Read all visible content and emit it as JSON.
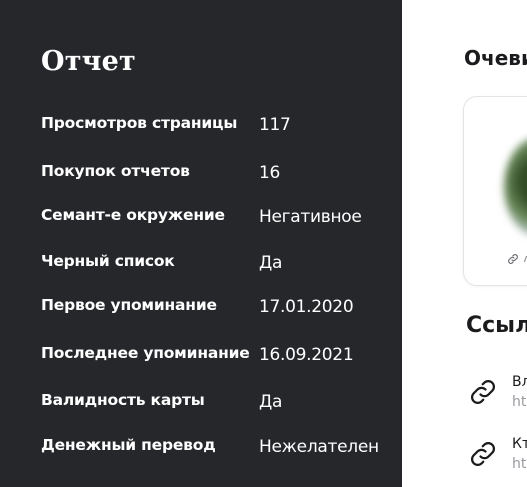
{
  "report": {
    "title": "Отчет",
    "rows": [
      {
        "label": "Просмотров страницы",
        "value": "117"
      },
      {
        "label": "Покупок отчетов",
        "value": "16"
      },
      {
        "label": "Семант-е окружение",
        "value": "Негативное"
      },
      {
        "label": "Черный список",
        "value": "Да"
      },
      {
        "label": "Первое упоминание",
        "value": "17.01.2020"
      },
      {
        "label": "Последнее упоминание",
        "value": "16.09.2021"
      },
      {
        "label": "Валидность карты",
        "value": "Да"
      },
      {
        "label": "Денежный перевод",
        "value": "Нежелателен"
      }
    ]
  },
  "eyewitness": {
    "title": "Очеви",
    "card_link_icon": "link-icon"
  },
  "links": {
    "title": "Ссыл",
    "items": [
      {
        "title": "Вл",
        "url": "ht",
        "icon": "link-icon"
      },
      {
        "title": "Кт",
        "url": "ht",
        "icon": "link-icon"
      }
    ]
  },
  "colors": {
    "panel_background": "#26272b",
    "panel_text": "#ffffff",
    "heading_text": "#1b1b1d",
    "url_text": "#9a9aa0"
  }
}
